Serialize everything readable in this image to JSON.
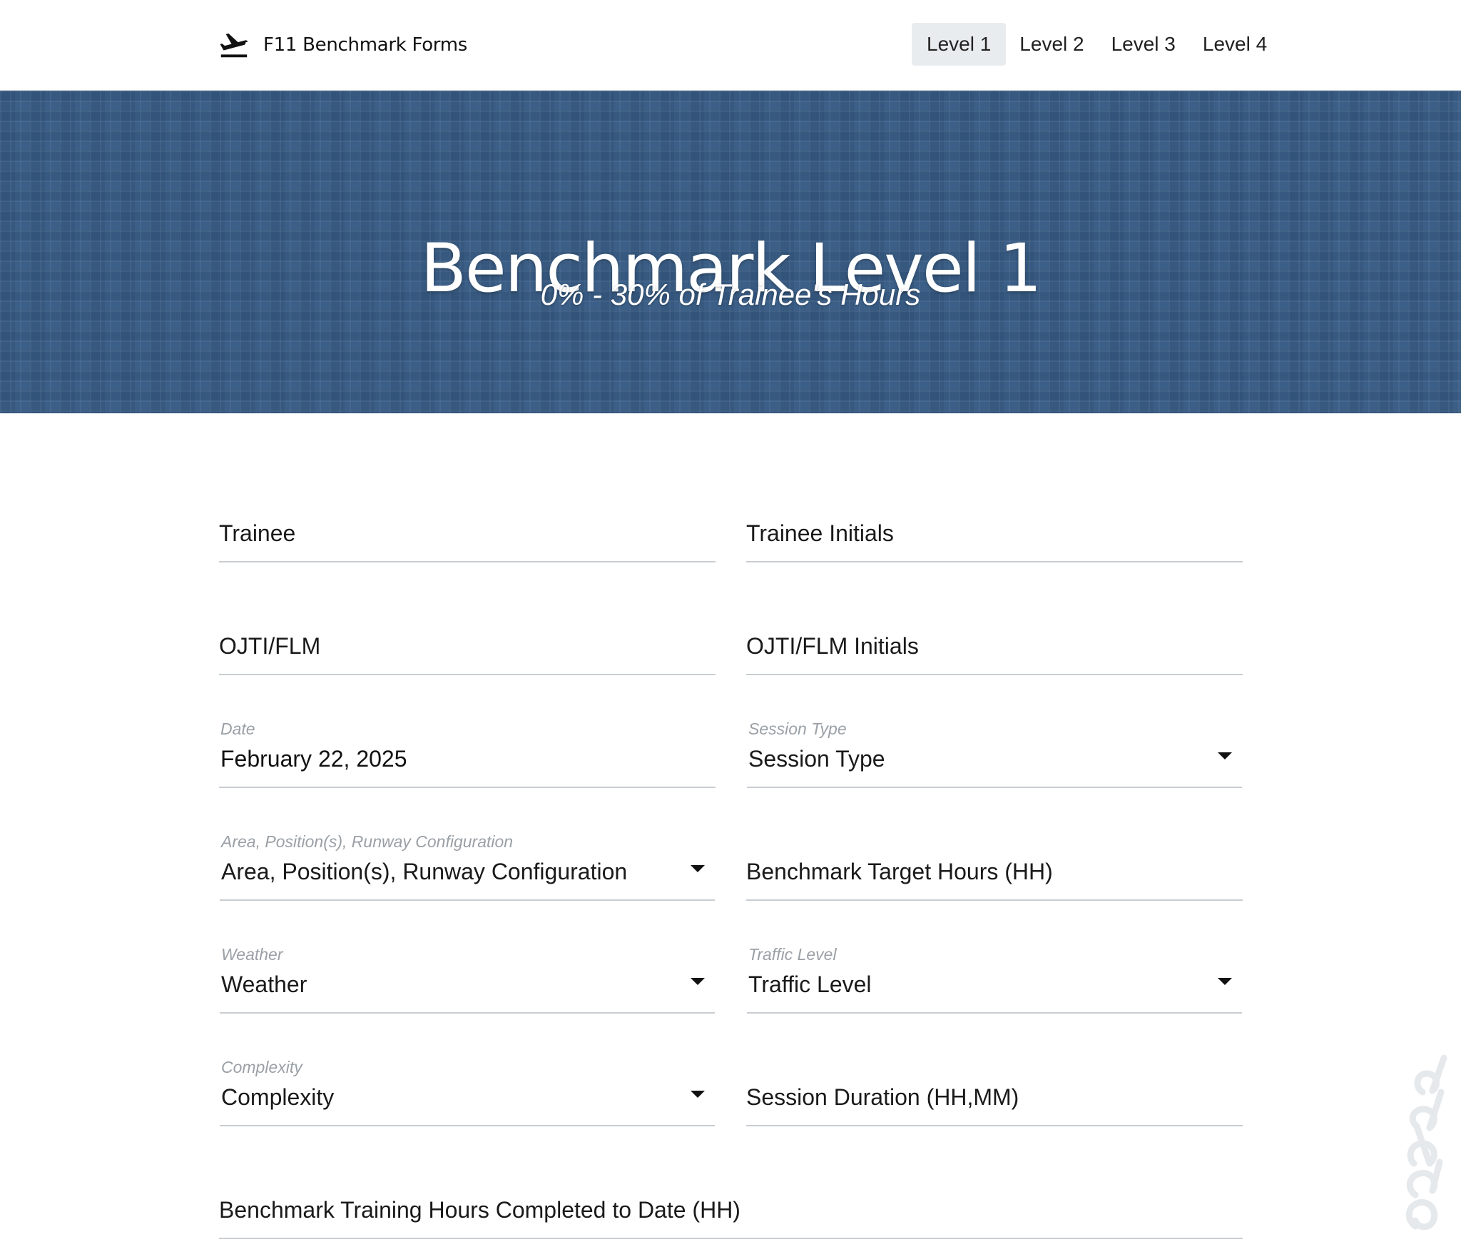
{
  "nav": {
    "brand": "F11 Benchmark Forms",
    "brand_icon": "airplane-departure-icon",
    "links": [
      "Level 1",
      "Level 2",
      "Level 3",
      "Level 4"
    ],
    "active_index": 0
  },
  "hero": {
    "title": "Benchmark Level 1",
    "subtitle": "0% - 30% of Trainee's Hours",
    "color": "#3b5f87"
  },
  "form": {
    "trainee": {
      "placeholder": "Trainee"
    },
    "trainee_initials": {
      "placeholder": "Trainee Initials"
    },
    "ojti": {
      "placeholder": "OJTI/FLM"
    },
    "ojti_initials": {
      "placeholder": "OJTI/FLM Initials"
    },
    "date": {
      "label": "Date",
      "value": "February 22, 2025"
    },
    "session_type": {
      "label": "Session Type",
      "value": "Session Type"
    },
    "area": {
      "label": "Area, Position(s), Runway Configuration",
      "value": "Area, Position(s), Runway Configuration"
    },
    "target_hours": {
      "placeholder": "Benchmark Target Hours (HH)"
    },
    "weather": {
      "label": "Weather",
      "value": "Weather"
    },
    "traffic": {
      "label": "Traffic Level",
      "value": "Traffic Level"
    },
    "complexity": {
      "label": "Complexity",
      "value": "Complexity"
    },
    "duration": {
      "placeholder": "Session Duration (HH,MM)"
    },
    "hours_completed": {
      "placeholder": "Benchmark Training Hours Completed to Date (HH)"
    }
  }
}
